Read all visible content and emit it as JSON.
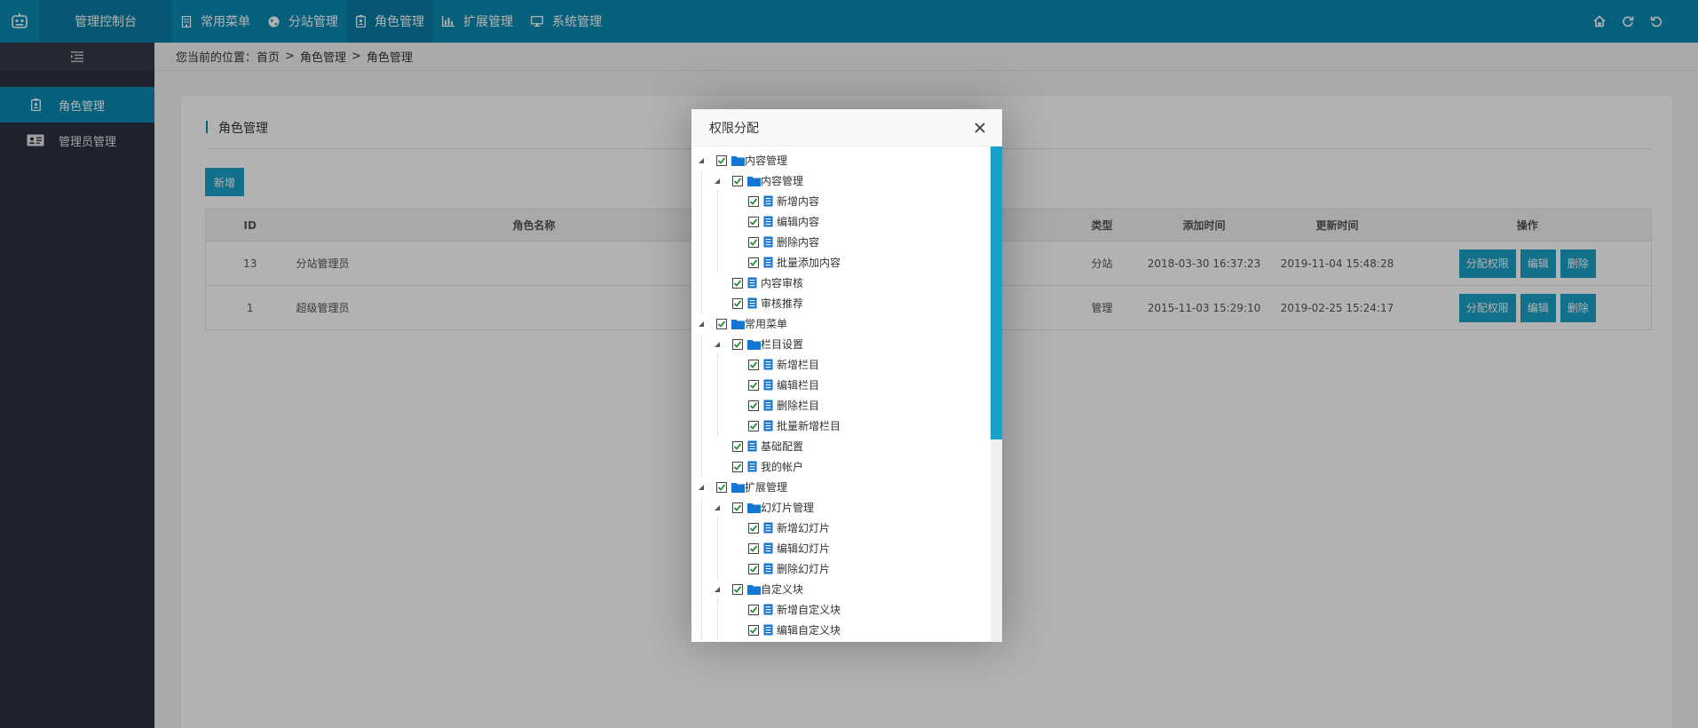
{
  "header": {
    "brand": "管理控制台",
    "nav": [
      {
        "label": "常用菜单",
        "icon": "building-icon"
      },
      {
        "label": "分站管理",
        "icon": "globe-icon"
      },
      {
        "label": "角色管理",
        "icon": "badge-icon"
      },
      {
        "label": "扩展管理",
        "icon": "bar-chart-icon"
      },
      {
        "label": "系统管理",
        "icon": "monitor-icon"
      }
    ],
    "active_nav": 2
  },
  "sidebar": {
    "items": [
      {
        "label": "角色管理",
        "icon": "badge-icon"
      },
      {
        "label": "管理员管理",
        "icon": "id-card-icon"
      }
    ],
    "active_item": 0
  },
  "breadcrumb": {
    "prefix": "您当前的位置：",
    "items": [
      "首页",
      "角色管理",
      "角色管理"
    ],
    "separator": ">"
  },
  "card": {
    "title": "角色管理",
    "add_label": "新增",
    "columns": {
      "id": "ID",
      "name": "角色名称",
      "type": "类型",
      "added": "添加时间",
      "updated": "更新时间",
      "ops": "操作"
    },
    "rows": [
      {
        "id": "13",
        "name": "分站管理员",
        "type": "分站",
        "added": "2018-03-30 16:37:23",
        "updated": "2019-11-04 15:48:28"
      },
      {
        "id": "1",
        "name": "超级管理员",
        "type": "管理",
        "added": "2015-11-03 15:29:10",
        "updated": "2019-02-25 15:24:17"
      }
    ],
    "op_labels": {
      "assign": "分配权限",
      "edit": "编辑",
      "delete": "删除"
    }
  },
  "modal": {
    "title": "权限分配",
    "tree": [
      {
        "label": "内容管理",
        "level": 0,
        "type": "folder",
        "expanded": true,
        "checked": true
      },
      {
        "label": "内容管理",
        "level": 1,
        "type": "folder",
        "expanded": true,
        "checked": true
      },
      {
        "label": "新增内容",
        "level": 2,
        "type": "file",
        "checked": true
      },
      {
        "label": "编辑内容",
        "level": 2,
        "type": "file",
        "checked": true
      },
      {
        "label": "删除内容",
        "level": 2,
        "type": "file",
        "checked": true
      },
      {
        "label": "批量添加内容",
        "level": 2,
        "type": "file",
        "checked": true
      },
      {
        "label": "内容审核",
        "level": 1,
        "type": "file",
        "checked": true
      },
      {
        "label": "审核推荐",
        "level": 1,
        "type": "file",
        "checked": true
      },
      {
        "label": "常用菜单",
        "level": 0,
        "type": "folder",
        "expanded": true,
        "checked": true
      },
      {
        "label": "栏目设置",
        "level": 1,
        "type": "folder",
        "expanded": true,
        "checked": true
      },
      {
        "label": "新增栏目",
        "level": 2,
        "type": "file",
        "checked": true
      },
      {
        "label": "编辑栏目",
        "level": 2,
        "type": "file",
        "checked": true
      },
      {
        "label": "删除栏目",
        "level": 2,
        "type": "file",
        "checked": true
      },
      {
        "label": "批量新增栏目",
        "level": 2,
        "type": "file",
        "checked": true
      },
      {
        "label": "基础配置",
        "level": 1,
        "type": "file",
        "checked": true
      },
      {
        "label": "我的帐户",
        "level": 1,
        "type": "file",
        "checked": true
      },
      {
        "label": "扩展管理",
        "level": 0,
        "type": "folder",
        "expanded": true,
        "checked": true
      },
      {
        "label": "幻灯片管理",
        "level": 1,
        "type": "folder",
        "expanded": true,
        "checked": true
      },
      {
        "label": "新增幻灯片",
        "level": 2,
        "type": "file",
        "checked": true
      },
      {
        "label": "编辑幻灯片",
        "level": 2,
        "type": "file",
        "checked": true
      },
      {
        "label": "删除幻灯片",
        "level": 2,
        "type": "file",
        "checked": true
      },
      {
        "label": "自定义块",
        "level": 1,
        "type": "folder",
        "expanded": true,
        "checked": true
      },
      {
        "label": "新增自定义块",
        "level": 2,
        "type": "file",
        "checked": true
      },
      {
        "label": "编辑自定义块",
        "level": 2,
        "type": "file",
        "checked": true
      }
    ]
  },
  "colors": {
    "primary": "#0b8bb3",
    "button": "#1aa1c8",
    "sidebar": "#2a3142",
    "check": "#2e8b3a",
    "tree_icon": "#1677d2"
  }
}
